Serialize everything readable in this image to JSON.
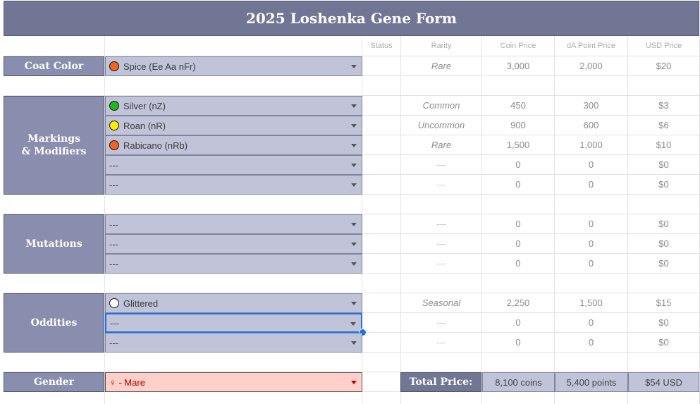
{
  "title": "2025 Loshenka Gene Form",
  "columns": {
    "status": "Status",
    "rarity": "Rarity",
    "coin": "Coin Price",
    "da": "dA Point Price",
    "usd": "USD Price"
  },
  "sections": {
    "coat_color": "Coat Color",
    "markings_line1": "Markings",
    "markings_line2": "& Modifiers",
    "mutations": "Mutations",
    "oddities": "Oddities",
    "gender": "Gender"
  },
  "rows": {
    "coat": {
      "label": "Spice (Ee Aa nFr)",
      "dot": "#f26522",
      "rarity": "Rare",
      "coin": "3,000",
      "da": "2,000",
      "usd": "$20"
    },
    "mark1": {
      "label": "Silver (nZ)",
      "dot": "#1fb81f",
      "rarity": "Common",
      "coin": "450",
      "da": "300",
      "usd": "$3"
    },
    "mark2": {
      "label": "Roan (nR)",
      "dot": "#ffee00",
      "rarity": "Uncommon",
      "coin": "900",
      "da": "600",
      "usd": "$6"
    },
    "mark3": {
      "label": "Rabicano (nRb)",
      "dot": "#f26522",
      "rarity": "Rare",
      "coin": "1,500",
      "da": "1,000",
      "usd": "$10"
    },
    "mark4": {
      "label": "---",
      "rarity": "---",
      "coin": "0",
      "da": "0",
      "usd": "$0"
    },
    "mark5": {
      "label": "---",
      "rarity": "---",
      "coin": "0",
      "da": "0",
      "usd": "$0"
    },
    "mut1": {
      "label": "---",
      "rarity": "---",
      "coin": "0",
      "da": "0",
      "usd": "$0"
    },
    "mut2": {
      "label": "---",
      "rarity": "---",
      "coin": "0",
      "da": "0",
      "usd": "$0"
    },
    "mut3": {
      "label": "---",
      "rarity": "---",
      "coin": "0",
      "da": "0",
      "usd": "$0"
    },
    "odd1": {
      "label": "Glittered",
      "dot": "#ffffff",
      "rarity": "Seasonal",
      "coin": "2,250",
      "da": "1,500",
      "usd": "$15"
    },
    "odd2": {
      "label": "---",
      "rarity": "---",
      "coin": "0",
      "da": "0",
      "usd": "$0"
    },
    "odd3": {
      "label": "---",
      "rarity": "---",
      "coin": "0",
      "da": "0",
      "usd": "$0"
    }
  },
  "gender": {
    "value": "♀ - Mare"
  },
  "total": {
    "label": "Total Price:",
    "coins": "8,100 coins",
    "points": "5,400 points",
    "usd": "$54 USD"
  },
  "colors": {
    "header_bg": "#707693",
    "label_bg": "#8a8eae",
    "dropdown_bg": "#c1c4d9",
    "gender_bg": "#ffcfc9",
    "gender_text": "#b10202",
    "selection": "#1a73e8"
  }
}
